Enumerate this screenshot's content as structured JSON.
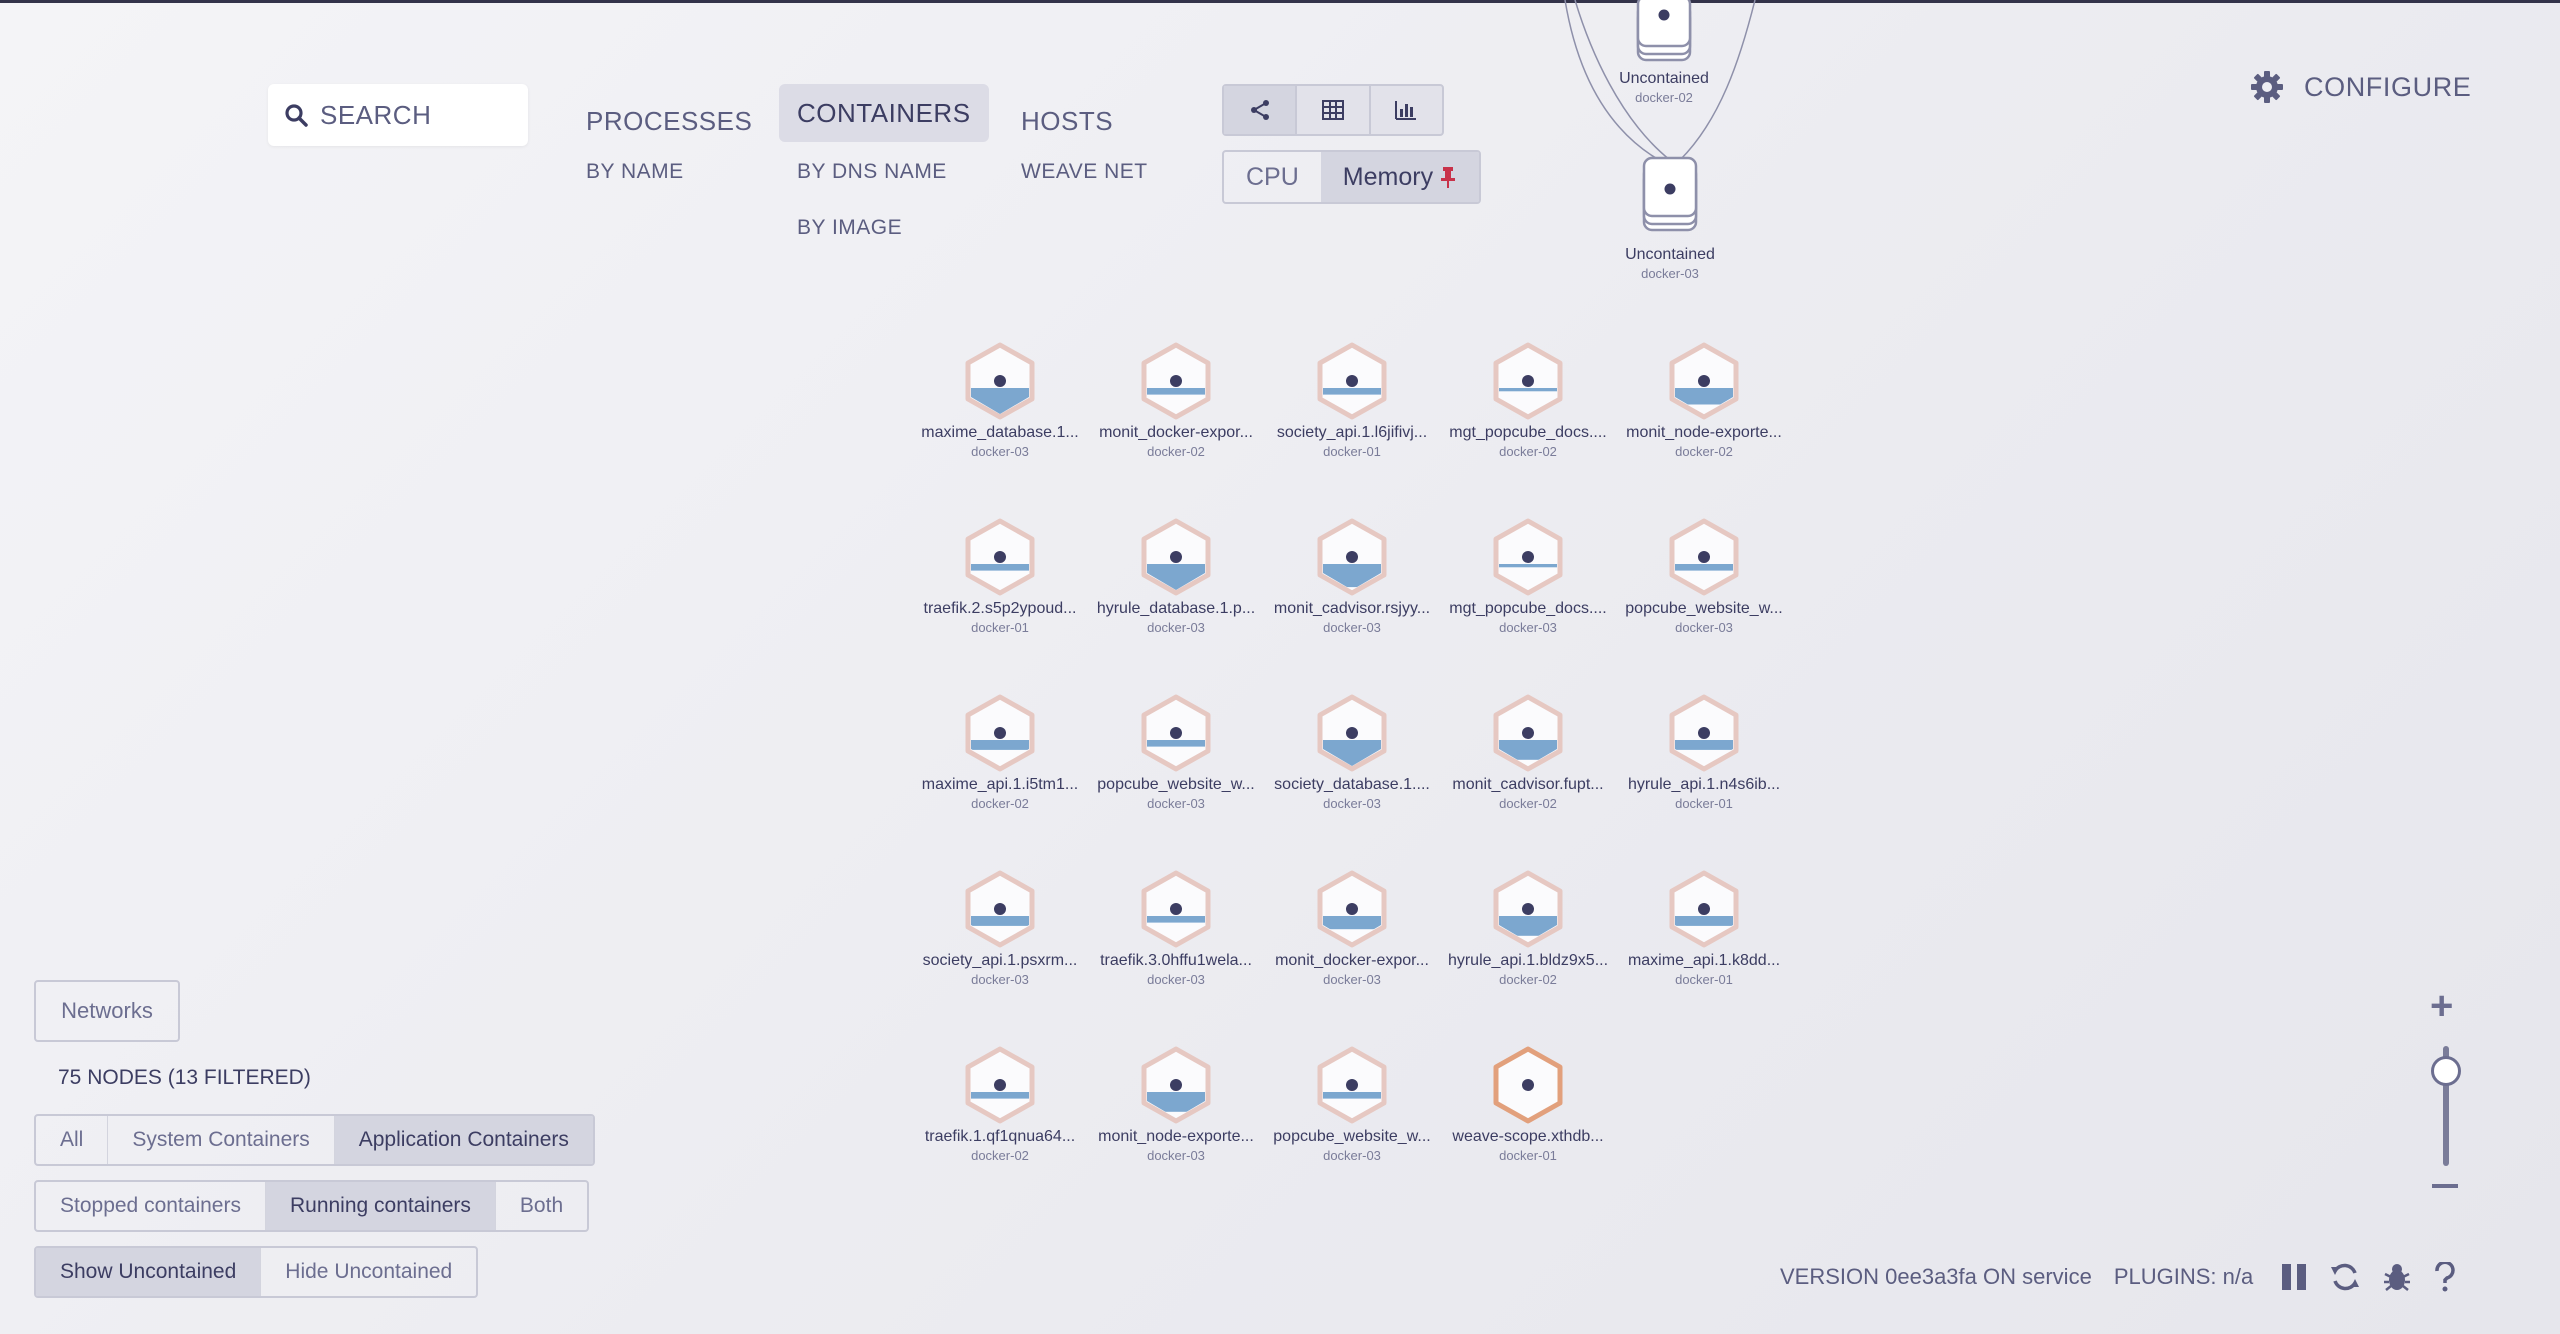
{
  "search": {
    "placeholder": "SEARCH"
  },
  "topologies": {
    "processes": {
      "label": "PROCESSES",
      "subs": [
        "BY NAME"
      ]
    },
    "containers": {
      "label": "CONTAINERS",
      "subs": [
        "BY DNS NAME",
        "BY IMAGE"
      ]
    },
    "hosts": {
      "label": "HOSTS",
      "subs": [
        "WEAVE NET"
      ]
    }
  },
  "view_modes": [
    "graph-icon",
    "table-icon",
    "resources-icon"
  ],
  "metric": {
    "cpu": "CPU",
    "memory": "Memory"
  },
  "configure": {
    "label": "CONFIGURE"
  },
  "uncontained": [
    {
      "label": "Uncontained",
      "host": "docker-02"
    },
    {
      "label": "Uncontained",
      "host": "docker-03"
    }
  ],
  "nodes": [
    {
      "label": "maxime_database.1...",
      "host": "docker-03",
      "fill": 0.45
    },
    {
      "label": "monit_docker-expor...",
      "host": "docker-02",
      "fill": 0.1
    },
    {
      "label": "society_api.1.l6jifivj...",
      "host": "docker-01",
      "fill": 0.1
    },
    {
      "label": "mgt_popcube_docs....",
      "host": "docker-02",
      "fill": 0.05
    },
    {
      "label": "monit_node-exporte...",
      "host": "docker-02",
      "fill": 0.25
    },
    {
      "label": "traefik.2.s5p2ypoud...",
      "host": "docker-01",
      "fill": 0.1
    },
    {
      "label": "hyrule_database.1.p...",
      "host": "docker-03",
      "fill": 0.5
    },
    {
      "label": "monit_cadvisor.rsjyy...",
      "host": "docker-03",
      "fill": 0.35
    },
    {
      "label": "mgt_popcube_docs....",
      "host": "docker-03",
      "fill": 0.05
    },
    {
      "label": "popcube_website_w...",
      "host": "docker-03",
      "fill": 0.1
    },
    {
      "label": "maxime_api.1.i5tm1...",
      "host": "docker-02",
      "fill": 0.15
    },
    {
      "label": "popcube_website_w...",
      "host": "docker-03",
      "fill": 0.1
    },
    {
      "label": "society_database.1....",
      "host": "docker-03",
      "fill": 0.5
    },
    {
      "label": "monit_cadvisor.fupt...",
      "host": "docker-02",
      "fill": 0.3
    },
    {
      "label": "hyrule_api.1.n4s6ib...",
      "host": "docker-01",
      "fill": 0.15
    },
    {
      "label": "society_api.1.psxrm...",
      "host": "docker-03",
      "fill": 0.15
    },
    {
      "label": "traefik.3.0hffu1wela...",
      "host": "docker-03",
      "fill": 0.1
    },
    {
      "label": "monit_docker-expor...",
      "host": "docker-03",
      "fill": 0.2
    },
    {
      "label": "hyrule_api.1.bldz9x5...",
      "host": "docker-02",
      "fill": 0.3
    },
    {
      "label": "maxime_api.1.k8dd...",
      "host": "docker-01",
      "fill": 0.15
    },
    {
      "label": "traefik.1.qf1qnua64...",
      "host": "docker-02",
      "fill": 0.1
    },
    {
      "label": "monit_node-exporte...",
      "host": "docker-03",
      "fill": 0.3
    },
    {
      "label": "popcube_website_w...",
      "host": "docker-03",
      "fill": 0.1
    },
    {
      "label": "weave-scope.xthdb...",
      "host": "docker-01",
      "fill": 0.0,
      "highlight": true
    }
  ],
  "networks": {
    "label": "Networks"
  },
  "node_count": "75 NODES (13 FILTERED)",
  "filters": {
    "type": [
      "All",
      "System Containers",
      "Application Containers"
    ],
    "state": [
      "Stopped containers",
      "Running containers",
      "Both"
    ],
    "uncontained": [
      "Show Uncontained",
      "Hide Uncontained"
    ]
  },
  "footer": {
    "version": "VERSION 0ee3a3fa ON service",
    "plugins": "PLUGINS: n/a"
  },
  "colors": {
    "accent": "#3c3d62",
    "memory_fill": "#7ca7cf",
    "node_border": "#e6c8c2",
    "highlight_border": "#e2a07c",
    "pin": "#c8324a"
  }
}
